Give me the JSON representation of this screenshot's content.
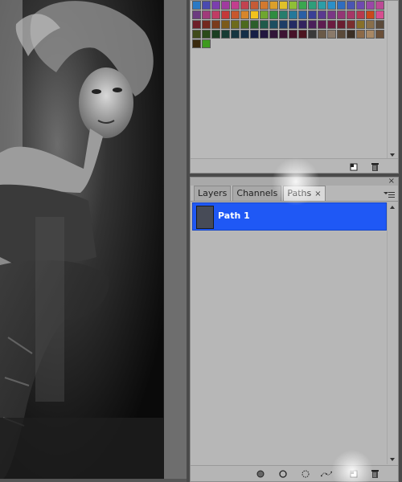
{
  "swatches": {
    "colors": [
      "#2a79c4",
      "#4a4ab0",
      "#7b3fae",
      "#a03c9f",
      "#c23f8e",
      "#c24350",
      "#c65b36",
      "#d3792f",
      "#dba02b",
      "#e0c12a",
      "#8fbf37",
      "#3aa64f",
      "#2f9e7a",
      "#2c9ea7",
      "#2b8fc8",
      "#2f6dbf",
      "#4a55b2",
      "#6f4ab0",
      "#9a48a7",
      "#bc4a95",
      "#6b3b7f",
      "#a03b7a",
      "#c03c64",
      "#c4393a",
      "#c8572e",
      "#d7862b",
      "#f2c21c",
      "#6fa62f",
      "#2f8c40",
      "#277d6c",
      "#25789a",
      "#2a5fa5",
      "#3a3f96",
      "#5a3a8f",
      "#7a3785",
      "#933675",
      "#a63767",
      "#b73a4f",
      "#c9491b",
      "#d74d8f",
      "#6e1e28",
      "#73281f",
      "#7a3b1c",
      "#7b5a1a",
      "#6e6b1c",
      "#4d6a1e",
      "#2d5e2a",
      "#1f5a4a",
      "#1c4e60",
      "#1d3c66",
      "#232b63",
      "#33235e",
      "#4a1f5a",
      "#5e1c50",
      "#6b1c40",
      "#6a1e30",
      "#7a2f2f",
      "#87702a",
      "#896f4a",
      "#5b4a3a",
      "#3f4a1a",
      "#2b4a1a",
      "#1b3f22",
      "#173c34",
      "#163640",
      "#142f48",
      "#161f45",
      "#22173f",
      "#311538",
      "#3c1333",
      "#461228",
      "#4c1520",
      "#3a3a3a",
      "#6a5a48",
      "#8a7a6a",
      "#5a4a3a",
      "#3b2f25",
      "#8c6a48",
      "#a88865",
      "#6a4f38",
      "#3a2a0e",
      "#3e9a1f"
    ]
  },
  "paths_panel": {
    "tabs": [
      {
        "label": "Layers"
      },
      {
        "label": "Channels"
      },
      {
        "label": "Paths",
        "close": "×"
      }
    ],
    "active_tab": "Paths",
    "close_glyph": "×",
    "rows": [
      {
        "label": "Path 1",
        "selected": true
      }
    ]
  },
  "colors": {
    "selection": "#1f58f5",
    "panel_bg": "#b7b7b7",
    "dock_bg": "#4a4a4a"
  },
  "icons": {
    "swatches_footer": [
      "new-swatch-icon",
      "trash-icon"
    ],
    "paths_footer": [
      "fill-path-icon",
      "stroke-path-icon",
      "load-selection-icon",
      "make-work-path-icon",
      "new-path-icon",
      "trash-icon"
    ]
  }
}
